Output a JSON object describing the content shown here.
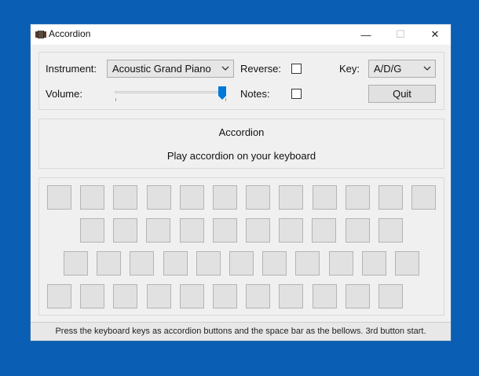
{
  "window": {
    "title": "Accordion",
    "controls": {
      "minimize": "—",
      "maximize": "☐",
      "close": "✕"
    }
  },
  "controls": {
    "instrument_label": "Instrument:",
    "instrument_value": "Acoustic Grand Piano",
    "reverse_label": "Reverse:",
    "reverse_checked": false,
    "key_label": "Key:",
    "key_value": "A/D/G",
    "volume_label": "Volume:",
    "volume_level": 1.0,
    "notes_label": "Notes:",
    "notes_checked": false,
    "quit_label": "Quit"
  },
  "info": {
    "title": "Accordion",
    "subtitle": "Play accordion on your keyboard"
  },
  "keyboard": {
    "rows": [
      12,
      10,
      11,
      11
    ]
  },
  "status": {
    "text": "Press the keyboard keys as accordion buttons and the space bar as the bellows. 3rd button start."
  },
  "colors": {
    "desktop": "#0a5fb4",
    "slider_thumb": "#0078d7"
  }
}
